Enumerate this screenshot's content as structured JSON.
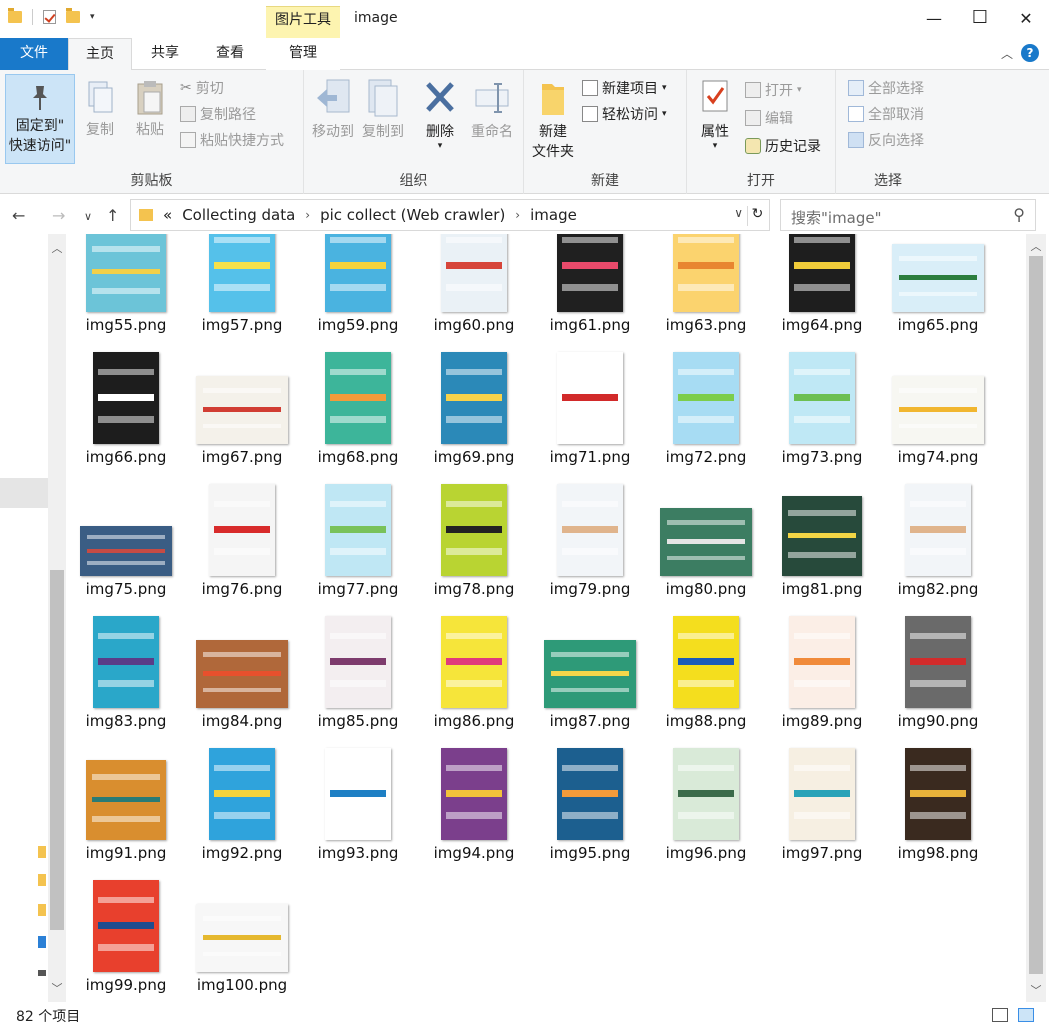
{
  "window": {
    "title": "image",
    "context_tab": "图片工具",
    "minimize": "—",
    "maximize": "☐",
    "close": "✕"
  },
  "ribbon_tabs": [
    "文件",
    "主页",
    "共享",
    "查看",
    "管理"
  ],
  "ribbon": {
    "clipboard": {
      "label": "剪贴板",
      "pin": "固定到\"\n快速访问\"",
      "pin_l1": "固定到\"",
      "pin_l2": "快速访问\"",
      "copy": "复制",
      "paste": "粘贴",
      "cut": "剪切",
      "copy_path": "复制路径",
      "paste_shortcut": "粘贴快捷方式"
    },
    "organize": {
      "label": "组织",
      "move_to": "移动到",
      "copy_to": "复制到",
      "delete": "删除",
      "rename": "重命名"
    },
    "new": {
      "label": "新建",
      "new_folder_l1": "新建",
      "new_folder_l2": "文件夹",
      "new_item": "新建项目",
      "easy_access": "轻松访问"
    },
    "open": {
      "label": "打开",
      "properties": "属性",
      "open": "打开",
      "edit": "编辑",
      "history": "历史记录"
    },
    "select": {
      "label": "选择",
      "select_all": "全部选择",
      "select_none": "全部取消",
      "invert": "反向选择"
    }
  },
  "address": {
    "overflow": "«",
    "crumbs": [
      "Collecting data",
      "pic collect (Web crawler)",
      "image"
    ],
    "search_placeholder": "搜索\"image\""
  },
  "files": [
    {
      "name": "img55.png",
      "color": "#6cc4d8",
      "accent": "#f2d04a",
      "shape": "square"
    },
    {
      "name": "img57.png",
      "color": "#55c1ea",
      "accent": "#f7e14a",
      "shape": "portrait"
    },
    {
      "name": "img59.png",
      "color": "#4ab3e0",
      "accent": "#f5d33c",
      "shape": "portrait"
    },
    {
      "name": "img60.png",
      "color": "#eaf1f6",
      "accent": "#d6453a",
      "shape": "portrait"
    },
    {
      "name": "img61.png",
      "color": "#202020",
      "accent": "#e94a6b",
      "shape": "portrait"
    },
    {
      "name": "img63.png",
      "color": "#fbd36e",
      "accent": "#e88630",
      "shape": "portrait"
    },
    {
      "name": "img64.png",
      "color": "#1e1e1e",
      "accent": "#f1cc3a",
      "shape": "portrait"
    },
    {
      "name": "img65.png",
      "color": "#d9eef8",
      "accent": "#2b7d3e",
      "shape": "landscape"
    },
    {
      "name": "img66.png",
      "color": "#1d1d1d",
      "accent": "#ffffff",
      "shape": "portrait"
    },
    {
      "name": "img67.png",
      "color": "#f4f1ea",
      "accent": "#d13d33",
      "shape": "landscape"
    },
    {
      "name": "img68.png",
      "color": "#3db59a",
      "accent": "#f39b3a",
      "shape": "portrait"
    },
    {
      "name": "img69.png",
      "color": "#2b89b8",
      "accent": "#f7d24a",
      "shape": "portrait"
    },
    {
      "name": "img71.png",
      "color": "#ffffff",
      "accent": "#d22a2a",
      "shape": "portrait"
    },
    {
      "name": "img72.png",
      "color": "#a7dcf3",
      "accent": "#7ccd4b",
      "shape": "portrait"
    },
    {
      "name": "img73.png",
      "color": "#bfe8f5",
      "accent": "#6cbf52",
      "shape": "portrait"
    },
    {
      "name": "img74.png",
      "color": "#f7f7f2",
      "accent": "#f1b62f",
      "shape": "landscape"
    },
    {
      "name": "img75.png",
      "color": "#3a5d84",
      "accent": "#c64b44",
      "shape": "wide"
    },
    {
      "name": "img76.png",
      "color": "#f5f5f5",
      "accent": "#d82b2b",
      "shape": "portrait"
    },
    {
      "name": "img77.png",
      "color": "#bfe7f4",
      "accent": "#79c25a",
      "shape": "portrait"
    },
    {
      "name": "img78.png",
      "color": "#b9d432",
      "accent": "#222222",
      "shape": "portrait"
    },
    {
      "name": "img79.png",
      "color": "#f2f5f8",
      "accent": "#e0b48c",
      "shape": "portrait"
    },
    {
      "name": "img80.png",
      "color": "#3c7d62",
      "accent": "#e5e5e5",
      "shape": "landscape"
    },
    {
      "name": "img81.png",
      "color": "#274a3b",
      "accent": "#f3d545",
      "shape": "square"
    },
    {
      "name": "img82.png",
      "color": "#f2f5f8",
      "accent": "#e0b48c",
      "shape": "portrait"
    },
    {
      "name": "img83.png",
      "color": "#2aa7c9",
      "accent": "#5a3c88",
      "shape": "portrait"
    },
    {
      "name": "img84.png",
      "color": "#b0683a",
      "accent": "#e8502d",
      "shape": "landscape"
    },
    {
      "name": "img85.png",
      "color": "#f3eef0",
      "accent": "#7d3b6d",
      "shape": "portrait"
    },
    {
      "name": "img86.png",
      "color": "#f6e53a",
      "accent": "#e03a7b",
      "shape": "portrait"
    },
    {
      "name": "img87.png",
      "color": "#2e9a78",
      "accent": "#f4d64a",
      "shape": "landscape"
    },
    {
      "name": "img88.png",
      "color": "#f4de1e",
      "accent": "#1b5ab8",
      "shape": "portrait"
    },
    {
      "name": "img89.png",
      "color": "#fbeee6",
      "accent": "#f08a3a",
      "shape": "portrait"
    },
    {
      "name": "img90.png",
      "color": "#6a6a6a",
      "accent": "#d22b2b",
      "shape": "portrait"
    },
    {
      "name": "img91.png",
      "color": "#d98e2f",
      "accent": "#2a7b75",
      "shape": "square"
    },
    {
      "name": "img92.png",
      "color": "#2fa3dc",
      "accent": "#f5d33c",
      "shape": "portrait"
    },
    {
      "name": "img93.png",
      "color": "#ffffff",
      "accent": "#1e7fc4",
      "shape": "portrait"
    },
    {
      "name": "img94.png",
      "color": "#7b3f8c",
      "accent": "#f2c33a",
      "shape": "portrait"
    },
    {
      "name": "img95.png",
      "color": "#1c5f8f",
      "accent": "#f39b3a",
      "shape": "portrait"
    },
    {
      "name": "img96.png",
      "color": "#d9ead8",
      "accent": "#3b6b4a",
      "shape": "portrait"
    },
    {
      "name": "img97.png",
      "color": "#f6efe2",
      "accent": "#2aa3b8",
      "shape": "portrait"
    },
    {
      "name": "img98.png",
      "color": "#3a2a1f",
      "accent": "#e8b23a",
      "shape": "portrait"
    },
    {
      "name": "img99.png",
      "color": "#e8402d",
      "accent": "#1f4c8f",
      "shape": "portrait"
    },
    {
      "name": "img100.png",
      "color": "#f7f7f7",
      "accent": "#e5b82f",
      "shape": "landscape"
    }
  ],
  "status": {
    "count": "82 个项目"
  }
}
